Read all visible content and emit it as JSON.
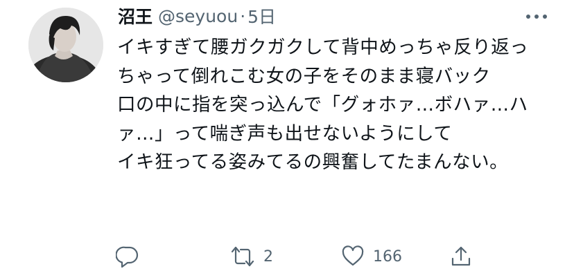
{
  "tweet": {
    "display_name": "沼王",
    "handle": "@seyuou",
    "separator": "·",
    "time": "5日",
    "text": "イキすぎて腰ガクガクして背中めっちゃ反り返っちゃって倒れこむ女の子をそのまま寝バック\n口の中に指を突っ込んで「グォホァ…ボハァ…ハァ…」って喘ぎ声も出せないようにして\nイキ狂ってる姿みてるの興奮してたまんない。"
  },
  "actions": {
    "reply_icon": "reply-icon",
    "retweet_icon": "retweet-icon",
    "retweet_count": "2",
    "like_icon": "heart-icon",
    "like_count": "166",
    "share_icon": "share-icon"
  },
  "colors": {
    "text": "#0f1419",
    "secondary": "#536471",
    "background": "#ffffff"
  }
}
